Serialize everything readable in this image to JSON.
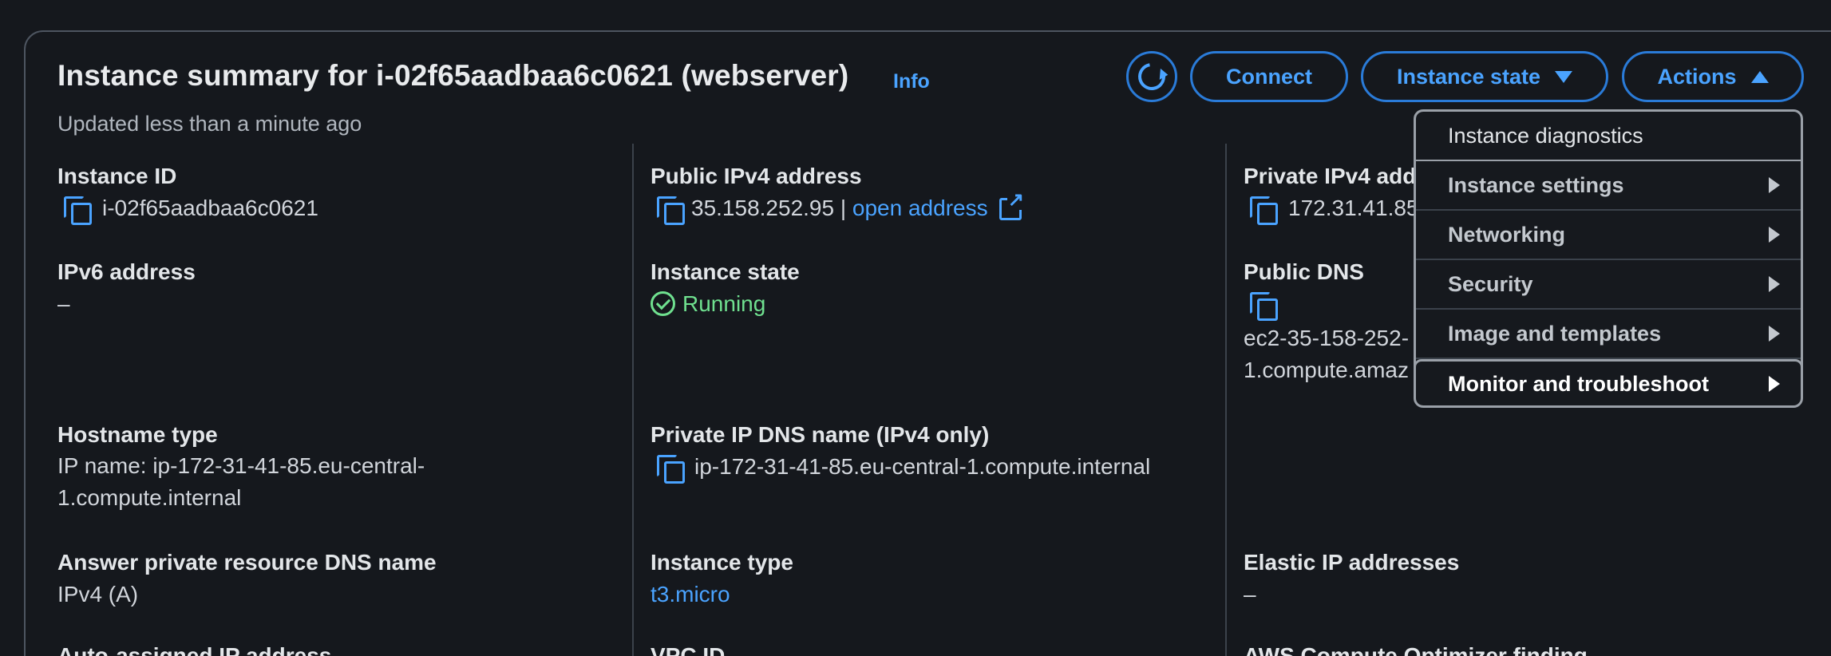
{
  "header": {
    "title": "Instance summary for i-02f65aadbaa6c0621 (webserver)",
    "info": "Info",
    "subtitle": "Updated less than a minute ago"
  },
  "buttons": {
    "refresh_icon": "refresh-icon",
    "connect": "Connect",
    "instance_state": "Instance state",
    "actions": "Actions"
  },
  "fields": {
    "instance_id": {
      "label": "Instance ID",
      "value": "i-02f65aadbaa6c0621"
    },
    "public_ipv4": {
      "label": "Public IPv4 address",
      "value": "35.158.252.95",
      "separator": "|",
      "link": "open address"
    },
    "private_ipv4": {
      "label": "Private IPv4 add",
      "value": "172.31.41.85"
    },
    "ipv6": {
      "label": "IPv6 address",
      "value": "–"
    },
    "instance_state": {
      "label": "Instance state",
      "value": "Running"
    },
    "public_dns": {
      "label": "Public DNS",
      "value_line1": "ec2-35-158-252-",
      "value_line2": "1.compute.amaz"
    },
    "hostname_type": {
      "label": "Hostname type",
      "value_line1": "IP name: ip-172-31-41-85.eu-central-",
      "value_line2": "1.compute.internal"
    },
    "private_dns": {
      "label": "Private IP DNS name (IPv4 only)",
      "value": "ip-172-31-41-85.eu-central-1.compute.internal"
    },
    "answer_dns": {
      "label": "Answer private resource DNS name",
      "value": "IPv4 (A)"
    },
    "instance_type": {
      "label": "Instance type",
      "value": "t3.micro"
    },
    "elastic_ip": {
      "label": "Elastic IP addresses",
      "value": "–"
    },
    "auto_assigned": {
      "label": "Auto-assigned IP address"
    },
    "vpc_id": {
      "label": "VPC ID"
    },
    "compute_optimizer": {
      "label": "AWS Compute Optimizer finding"
    }
  },
  "actions_menu": {
    "items": [
      {
        "label": "Instance diagnostics"
      },
      {
        "label": "Instance settings"
      },
      {
        "label": "Networking"
      },
      {
        "label": "Security"
      },
      {
        "label": "Image and templates"
      },
      {
        "label": "Monitor and troubleshoot"
      }
    ]
  },
  "colors": {
    "background": "#15181d",
    "link": "#4aa3ff",
    "running": "#6fe08f",
    "border": "#4d5560"
  }
}
